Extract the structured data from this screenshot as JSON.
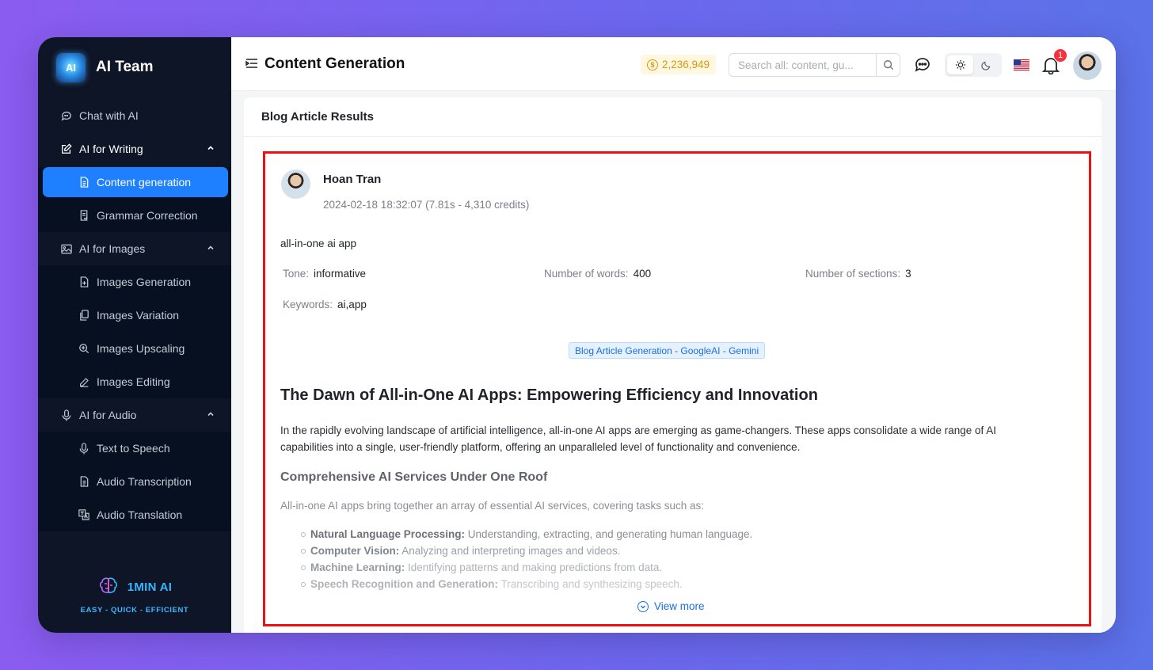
{
  "sidebar": {
    "brand": "AI Team",
    "brand_logo_text": "AI",
    "chat": "Chat with AI",
    "groups": [
      {
        "label": "AI for Writing",
        "items": [
          "Content generation",
          "Grammar Correction"
        ]
      },
      {
        "label": "AI for Images",
        "items": [
          "Images Generation",
          "Images Variation",
          "Images Upscaling",
          "Images Editing"
        ]
      },
      {
        "label": "AI for Audio",
        "items": [
          "Text to Speech",
          "Audio Transcription",
          "Audio Translation"
        ]
      }
    ],
    "footer_name": "1MIN AI",
    "footer_tagline": "EASY - QUICK - EFFICIENT"
  },
  "header": {
    "title": "Content Generation",
    "credits": "2,236,949",
    "search_placeholder": "Search all: content, gu...",
    "notification_count": "1"
  },
  "card": {
    "title": "Blog Article Results",
    "user_name": "Hoan Tran",
    "meta": "2024-02-18 18:32:07 (7.81s - 4,310 credits)",
    "prompt": "all-in-one ai app",
    "params": {
      "tone_label": "Tone",
      "tone": "informative",
      "words_label": "Number of words",
      "words": "400",
      "sections_label": "Number of sections",
      "sections": "3",
      "keywords_label": "Keywords",
      "keywords": "ai,app"
    },
    "model_tag": "Blog Article Generation - GoogleAI - Gemini",
    "article": {
      "h1": "The Dawn of All-in-One AI Apps: Empowering Efficiency and Innovation",
      "intro": "In the rapidly evolving landscape of artificial intelligence, all-in-one AI apps are emerging as game-changers. These apps consolidate a wide range of AI capabilities into a single, user-friendly platform, offering an unparalleled level of functionality and convenience.",
      "h2": "Comprehensive AI Services Under One Roof",
      "p2": "All-in-one AI apps bring together an array of essential AI services, covering tasks such as:",
      "list": [
        {
          "term": "Natural Language Processing:",
          "desc": " Understanding, extracting, and generating human language."
        },
        {
          "term": "Computer Vision:",
          "desc": " Analyzing and interpreting images and videos."
        },
        {
          "term": "Machine Learning:",
          "desc": " Identifying patterns and making predictions from data."
        },
        {
          "term": "Speech Recognition and Generation:",
          "desc": " Transcribing and synthesizing speech."
        }
      ]
    },
    "view_more": "View more"
  },
  "colors": {
    "accent": "#1e80ff",
    "sidebar_bg": "#0d1526",
    "highlight_border": "#ee1111",
    "credits_text": "#d39a0e",
    "badge": "#f5313c"
  }
}
